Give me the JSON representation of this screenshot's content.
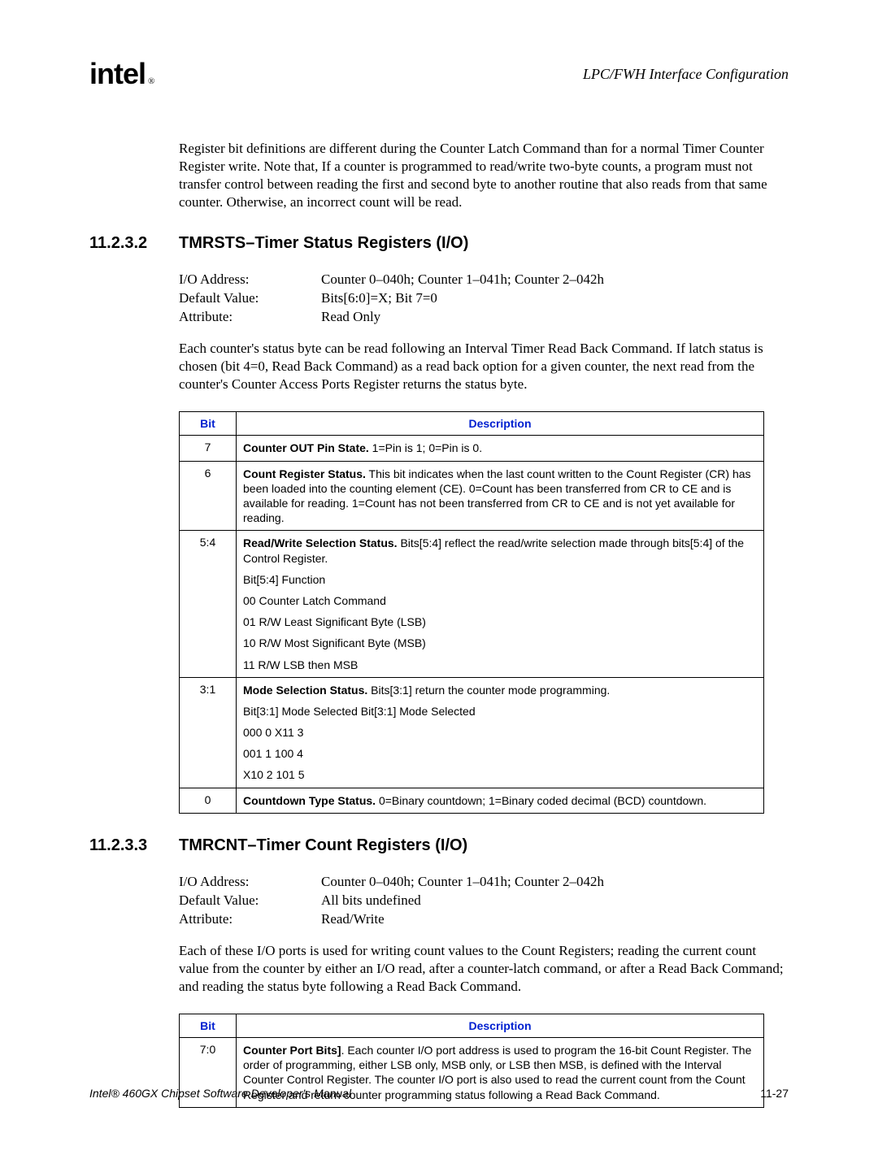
{
  "header": {
    "logo_main": "int",
    "logo_sub": "el",
    "logo_r": "®",
    "right": "LPC/FWH Interface Configuration"
  },
  "intro_para": "Register bit definitions are different during the Counter Latch Command than for a normal Timer Counter Register write. Note that, If a counter is programmed to read/write two-byte counts, a program must not transfer control between reading the first and second byte to another routine that also reads from that same counter. Otherwise, an incorrect count will be read.",
  "sec1": {
    "num": "11.2.3.2",
    "title": "TMRSTS–Timer Status Registers (I/O)",
    "attrs": {
      "io_label": "I/O Address:",
      "io_value": "Counter 0–040h; Counter 1–041h; Counter 2–042h",
      "def_label": "Default Value:",
      "def_value": "Bits[6:0]=X; Bit 7=0",
      "attr_label": "Attribute:",
      "attr_value": "Read Only"
    },
    "para": "Each counter's status byte can be read following an Interval Timer Read Back Command. If latch status is chosen (bit 4=0, Read Back Command) as a read back option for a given counter, the next read from the counter's Counter Access Ports Register returns the status byte.",
    "table": {
      "bit_header": "Bit",
      "desc_header": "Description",
      "rows": [
        {
          "bit": "7",
          "lead": "Counter OUT Pin State.",
          "lines": [
            " 1=Pin is 1; 0=Pin is 0."
          ]
        },
        {
          "bit": "6",
          "lead": "Count Register Status.",
          "lines": [
            " This bit indicates when the last count written to the Count Register (CR) has been loaded into the counting element (CE). 0=Count has been transferred from CR to CE and is available for reading. 1=Count has not been transferred from CR to CE and is not yet available for reading."
          ]
        },
        {
          "bit": "5:4",
          "lead": "Read/Write Selection Status.",
          "lines": [
            " Bits[5:4] reflect the read/write selection made through bits[5:4] of the Control Register.",
            "Bit[5:4] Function",
            "00 Counter Latch Command",
            "01 R/W Least Significant Byte (LSB)",
            "10 R/W Most Significant Byte (MSB)",
            "11 R/W LSB then MSB"
          ]
        },
        {
          "bit": "3:1",
          "lead": "Mode Selection Status.",
          "lines": [
            " Bits[3:1] return the counter mode programming.",
            "Bit[3:1] Mode Selected Bit[3:1] Mode Selected",
            "000 0 X11 3",
            "001 1 100 4",
            "X10 2 101 5"
          ]
        },
        {
          "bit": "0",
          "lead": "Countdown Type Status.",
          "lines": [
            " 0=Binary countdown; 1=Binary coded decimal (BCD) countdown."
          ]
        }
      ]
    }
  },
  "sec2": {
    "num": "11.2.3.3",
    "title": "TMRCNT–Timer Count Registers (I/O)",
    "attrs": {
      "io_label": "I/O Address:",
      "io_value": "Counter 0–040h; Counter 1–041h; Counter 2–042h",
      "def_label": "Default Value:",
      "def_value": "All bits undefined",
      "attr_label": "Attribute:",
      "attr_value": "Read/Write"
    },
    "para": "Each of these I/O ports is used for writing count values to the Count Registers; reading the current count value from the counter by either an I/O read, after a counter-latch command, or after a Read Back Command; and reading the status byte following a Read Back Command.",
    "table": {
      "bit_header": "Bit",
      "desc_header": "Description",
      "rows": [
        {
          "bit": "7:0",
          "lead": "Counter Port Bits]",
          "lines": [
            ". Each counter I/O port address is used to program the 16-bit Count Register. The order of programming, either LSB only, MSB only, or LSB then MSB, is defined with the Interval Counter Control Register. The counter I/O port is also used to read the current count from the Count Register and return counter programming status following a Read Back Command."
          ]
        }
      ]
    }
  },
  "footer": {
    "left": "Intel® 460GX Chipset Software Developer's Manual",
    "right": "11-27"
  }
}
